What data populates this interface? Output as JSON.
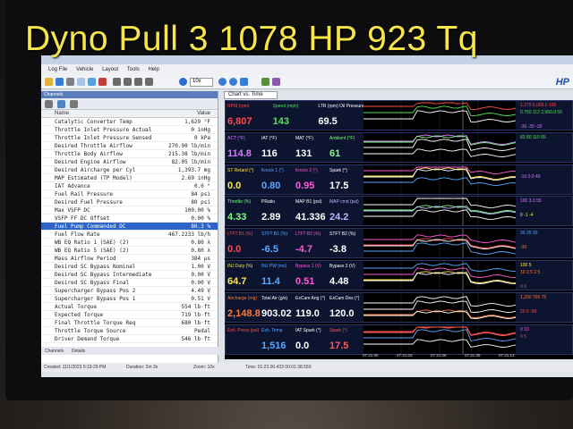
{
  "overlay_title": "Dyno Pull 3 1078 HP 923 Tq",
  "menu": [
    "Log File",
    "Vehicle",
    "Layout",
    "Tools",
    "Help"
  ],
  "toolbar": {
    "zoom_value": "10x"
  },
  "logo": "HP",
  "left_panel": {
    "header": "Channels",
    "col_name": "Name",
    "col_value": "Value",
    "rows": [
      {
        "name": "Catalytic Converter Temp",
        "value": "1,629 °F"
      },
      {
        "name": "Throttle Inlet Pressure Actual",
        "value": "0 inHg"
      },
      {
        "name": "Throttle Inlet Pressure Sensed",
        "value": "0 kPa"
      },
      {
        "name": "Desired Throttle Airflow",
        "value": "270.90 lb/min"
      },
      {
        "name": "Throttle Body Airflow",
        "value": "215.38 lb/min"
      },
      {
        "name": "Desired Engine Airflow",
        "value": "82.05 lb/min"
      },
      {
        "name": "Desired Aircharge per Cyl",
        "value": "1,393.7 mg"
      },
      {
        "name": "MAP Estimated (TP Model)",
        "value": "2.69 inHg"
      },
      {
        "name": "IAT Advance",
        "value": "0.0 °"
      },
      {
        "name": "Fuel Rail Pressure",
        "value": "84 psi"
      },
      {
        "name": "Desired Fuel Pressure",
        "value": "80 psi"
      },
      {
        "name": "Max VSFP DC",
        "value": "100.00 %"
      },
      {
        "name": "VSFP FF DC Offset",
        "value": "0.00 %"
      },
      {
        "name": "Fuel Pump Commanded DC",
        "value": "80.3 %"
      },
      {
        "name": "Fuel Flow Rate",
        "value": "467.2233 lb/h"
      },
      {
        "name": "WB EQ Ratio 1 (SAE) (2)",
        "value": "0.80 λ"
      },
      {
        "name": "WB EQ Ratio 5 (SAE) (2)",
        "value": "0.80 λ"
      },
      {
        "name": "Mass Airflow Period",
        "value": "384 µs"
      },
      {
        "name": "Desired SC Bypass Nominal",
        "value": "1.00 V"
      },
      {
        "name": "Desired SC Bypass Intermediate",
        "value": "0.00 V"
      },
      {
        "name": "Desired SC Bypass Final",
        "value": "0.00 V"
      },
      {
        "name": "Supercharger Bypass Pos 2",
        "value": "4.49 V"
      },
      {
        "name": "Supercharger Bypass Pos 1",
        "value": "0.51 V"
      },
      {
        "name": "Actual Torque",
        "value": "554 lb·ft"
      },
      {
        "name": "Expected Torque",
        "value": "719 lb·ft"
      },
      {
        "name": "Final Throttle Torque Req",
        "value": "680 lb·ft"
      },
      {
        "name": "Throttle Torque Source",
        "value": "Pedal"
      },
      {
        "name": "Driver Demand Torque",
        "value": "546 lb·ft"
      }
    ],
    "selected_index": 13,
    "tabs": [
      "Channels",
      "Details"
    ]
  },
  "status": {
    "created": "Created: 11/1/2023 5:19:29 PM",
    "duration": "Duration: 2m 3s",
    "zoom": "Zoom: 10x",
    "time": "Time: 01:23.00.433 00:01:38.550"
  },
  "chart_tab": "Chart vs. Time",
  "panels": [
    {
      "cells": [
        {
          "label": "RPM (rpm)",
          "value": "6,807",
          "color": "#ff4a4a"
        },
        {
          "label": "Speed (mph)",
          "value": "143",
          "color": "#56e05a"
        },
        {
          "label": "LTR (rpm) Oil Pressure (psi)",
          "value": "69.5",
          "color": "#ffffff"
        }
      ],
      "right": [
        "1.270 6,000.0 100",
        "0.750 112 2,960.9 50",
        "",
        "-30 -30 -30"
      ]
    },
    {
      "cells": [
        {
          "label": "ACT (°F)",
          "value": "114.8",
          "color": "#d57bff"
        },
        {
          "label": "IAT (°F)",
          "value": "116",
          "color": "#ffffff"
        },
        {
          "label": "MAT (°F)",
          "value": "131",
          "color": "#ffffff"
        },
        {
          "label": "Ambient (°F)",
          "value": "61",
          "color": "#7dff7d"
        }
      ],
      "right": [
        "83 80 115 65",
        "",
        "",
        ""
      ]
    },
    {
      "cells": [
        {
          "label": "ST Retard (°)",
          "value": "0.0",
          "color": "#ffe64a"
        },
        {
          "label": "Knock 1 (°)",
          "value": "0.80",
          "color": "#5aa8ff"
        },
        {
          "label": "Knock 2 (°)",
          "value": "0.95",
          "color": "#ff5ad7"
        },
        {
          "label": "Spark (°)",
          "value": "17.5",
          "color": "#ffffff"
        }
      ],
      "right": [
        "",
        "-10 0.0 40",
        "",
        ""
      ]
    },
    {
      "cells": [
        {
          "label": "Throttle (%)",
          "value": "4.33",
          "color": "#7dff7d"
        },
        {
          "label": "PRatio",
          "value": "2.89",
          "color": "#ffffff"
        },
        {
          "label": "MAP B1 (psi)",
          "value": "41.336",
          "color": "#ffffff"
        },
        {
          "label": "MAP cmd (psi)",
          "value": "24.2",
          "color": "#b9b9ff"
        }
      ],
      "right": [
        "100 3.3 55",
        "",
        "0 -1 -4",
        ""
      ]
    },
    {
      "cells": [
        {
          "label": "LTFT B1 (%)",
          "value": "0.0",
          "color": "#ff4a4a"
        },
        {
          "label": "STFT B1 (%)",
          "value": "-6.5",
          "color": "#5aa8ff"
        },
        {
          "label": "LTFT B2 (%)",
          "value": "-4.7",
          "color": "#ff5ad7"
        },
        {
          "label": "STFT B2 (%)",
          "value": "-3.8",
          "color": "#ffffff"
        }
      ],
      "right": [
        "30 25 30",
        "",
        "-30",
        ""
      ]
    },
    {
      "cells": [
        {
          "label": "INJ Duty (%)",
          "value": "64.7",
          "color": "#ffe64a"
        },
        {
          "label": "INJ PW (ms)",
          "value": "11.4",
          "color": "#5aa8ff"
        },
        {
          "label": "Bypass 1 (V)",
          "value": "0.51",
          "color": "#ff5ad7"
        },
        {
          "label": "Bypass 2 (V)",
          "value": "4.48",
          "color": "#ffffff"
        }
      ],
      "right": [
        "100 5",
        "10 2.5 2.5",
        "",
        "0 0"
      ]
    },
    {
      "cells": [
        {
          "label": "Aircharge (mg)",
          "value": "2,148.8",
          "color": "#ff7b3a"
        },
        {
          "label": "Total Air (g/s)",
          "value": "903.02",
          "color": "#ffffff"
        },
        {
          "label": "ExCam Ang (°)",
          "value": "119.0",
          "color": "#ffffff"
        },
        {
          "label": "ExCam Des (°)",
          "value": "120.0",
          "color": "#ffffff"
        }
      ],
      "right": [
        "1,200 700 75",
        "",
        "20 5 -90",
        ""
      ]
    },
    {
      "cells": [
        {
          "label": "Exh. Press (psi)",
          "value": "",
          "color": "#ff4a4a"
        },
        {
          "label": "Exh. Temp",
          "value": "1,516",
          "color": "#5aa8ff"
        },
        {
          "label": "IAT Spark (°)",
          "value": "0.0",
          "color": "#ffffff"
        },
        {
          "label": "Spark (°)",
          "value": "17.5",
          "color": "#ff5a5a"
        }
      ],
      "right": [
        "0 10",
        "0 5",
        "",
        ""
      ]
    }
  ],
  "time_axis": [
    "07:21.00",
    "07:21.03",
    "07:21.06",
    "07:21.09",
    "07:21.12"
  ]
}
